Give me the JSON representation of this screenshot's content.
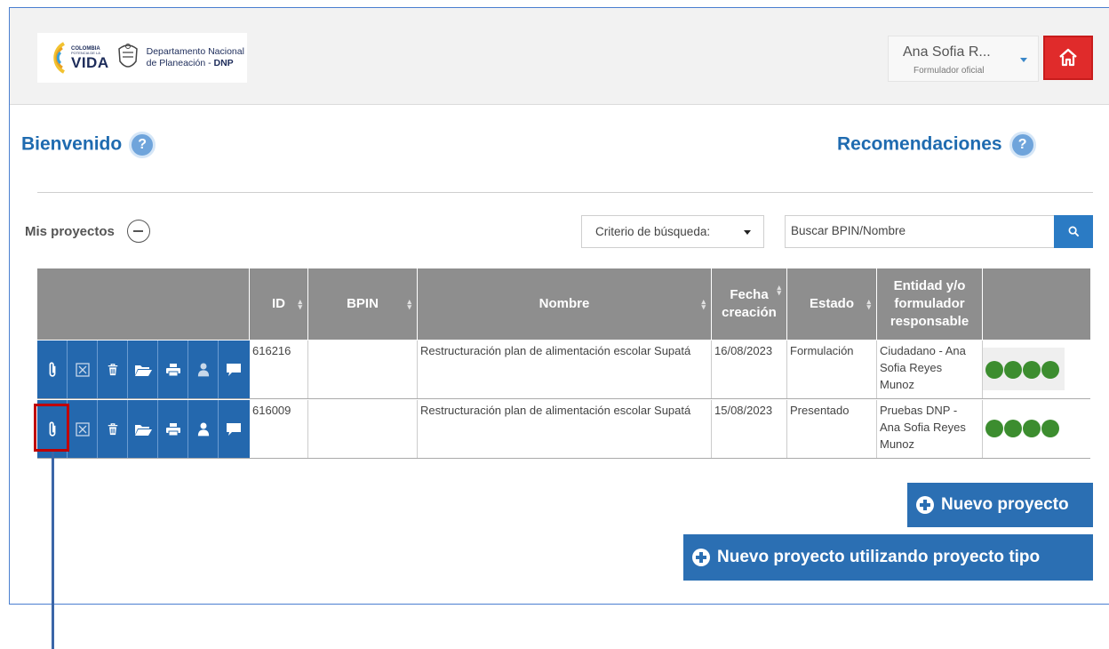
{
  "header": {
    "logo_colombia": "COLOMBIA",
    "logo_potencia": "POTENCIA DE LA",
    "logo_vida": "VIDA",
    "logo_dnp_line1": "Departamento Nacional",
    "logo_dnp_line2": "de Planeación - ",
    "logo_dnp_bold": "DNP",
    "user_name": "Ana Sofia R...",
    "user_role": "Formulador oficial",
    "home_icon": "home-icon"
  },
  "welcome": {
    "title": "Bienvenido",
    "help": "?"
  },
  "recommendations": {
    "title": "Recomendaciones",
    "help": "?"
  },
  "projects": {
    "title": "Mis proyectos",
    "criteria_label": "Criterio de búsqueda:",
    "search_placeholder": "Buscar BPIN/Nombre"
  },
  "table": {
    "columns": {
      "id": "ID",
      "bpin": "BPIN",
      "nombre": "Nombre",
      "fecha_line1": "Fecha",
      "fecha_line2": "creación",
      "estado": "Estado",
      "entidad_line1": "Entidad y/o",
      "entidad_line2": "formulador",
      "entidad_line3": "responsable"
    },
    "rows": [
      {
        "id": "616216",
        "bpin": "",
        "nombre": "Restructuración plan de alimentación escolar Supatá",
        "fecha": "16/08/2023",
        "estado": "Formulación",
        "entidad": "Ciudadano - Ana Sofia Reyes Munoz"
      },
      {
        "id": "616009",
        "bpin": "",
        "nombre": "Restructuración plan de alimentación escolar Supatá",
        "fecha": "15/08/2023",
        "estado": "Presentado",
        "entidad": "Pruebas DNP - Ana Sofia Reyes Munoz"
      }
    ],
    "status_dot_color": "#3c8d2f",
    "action_icons": [
      "paperclip-icon",
      "close-box-icon",
      "trash-icon",
      "folder-icon",
      "print-icon",
      "user-icon",
      "comment-icon"
    ]
  },
  "buttons": {
    "new_project": "Nuevo proyecto",
    "new_project_type": "Nuevo proyecto utilizando proyecto tipo"
  },
  "colors": {
    "brand_blue": "#2468ae",
    "title_blue": "#1f6bb0",
    "home_red": "#e02b2b",
    "highlight_red": "#c00000"
  }
}
